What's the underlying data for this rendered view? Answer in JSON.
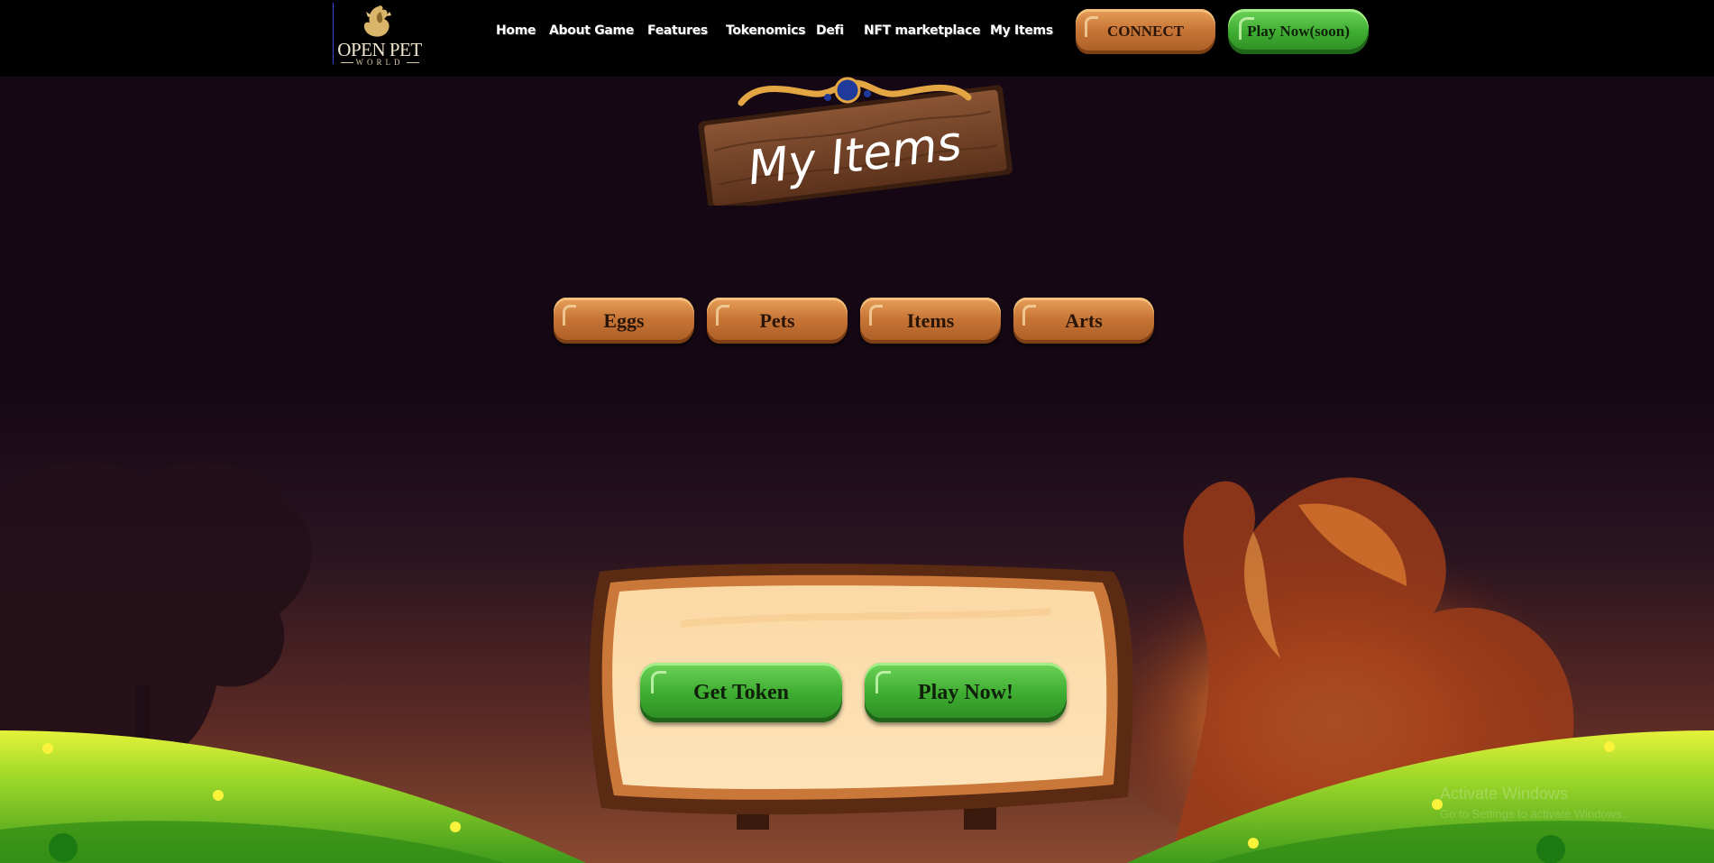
{
  "logo": {
    "name": "OPEN PET",
    "sub": "WORLD"
  },
  "nav": {
    "home": "Home",
    "about": "About Game",
    "features": "Features",
    "tokenomics": "Tokenomics",
    "defi": "Defi",
    "marketplace": "NFT marketplace",
    "my_items": "My Items"
  },
  "header_buttons": {
    "connect": "CONNECT",
    "play_soon": "Play Now(soon)"
  },
  "page": {
    "title": "My Items"
  },
  "tabs": [
    "Eggs",
    "Pets",
    "Items",
    "Arts"
  ],
  "board_buttons": {
    "get_token": "Get Token",
    "play_now": "Play Now!"
  },
  "watermark": {
    "line1": "Activate Windows",
    "line2": "Go to Settings to activate Windows."
  },
  "colors": {
    "header_bg": "#000000",
    "page_bg": "#150814",
    "wood": "#c87637",
    "green": "#3fae32"
  }
}
